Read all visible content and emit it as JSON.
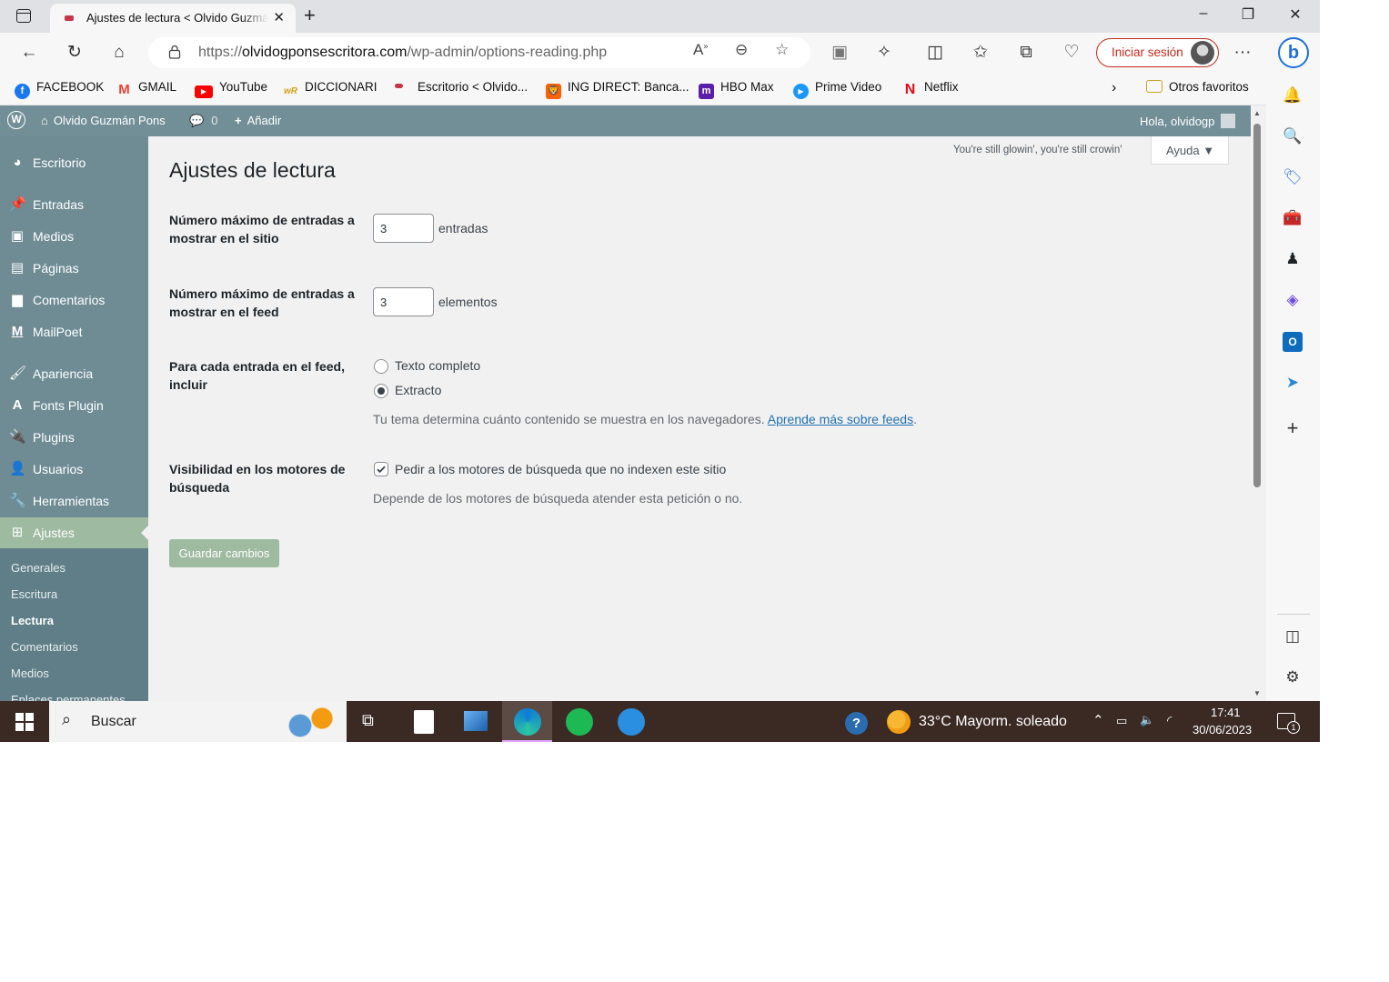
{
  "browser": {
    "tab_title": "Ajustes de lectura < Olvido Guzmán Pons — WordPress",
    "url_host": "olvidogponsescritora.com",
    "url_prefix": "https://",
    "url_path": "/wp-admin/options-reading.php",
    "signin_label": "Iniciar sesión",
    "bookmarks": [
      "FACEBOOK",
      "GMAIL",
      "YouTube",
      "DICCIONARI",
      "Escritorio < Olvido...",
      "ING DIRECT: Banca...",
      "HBO Max",
      "Prime Video",
      "Netflix"
    ],
    "other_favorites": "Otros favoritos"
  },
  "adminbar": {
    "site_name": "Olvido Guzmán Pons",
    "comments_count": "0",
    "add_label": "Añadir",
    "greeting": "Hola, olvidogp"
  },
  "sidebar": {
    "items": [
      {
        "label": "Escritorio",
        "icon": "dashboard-icon"
      },
      {
        "label": "Entradas",
        "icon": "pin-icon"
      },
      {
        "label": "Medios",
        "icon": "media-icon"
      },
      {
        "label": "Páginas",
        "icon": "page-icon"
      },
      {
        "label": "Comentarios",
        "icon": "comment-icon"
      },
      {
        "label": "MailPoet",
        "icon": "mailpoet-icon"
      },
      {
        "label": "Apariencia",
        "icon": "brush-icon"
      },
      {
        "label": "Fonts Plugin",
        "icon": "font-icon"
      },
      {
        "label": "Plugins",
        "icon": "plugin-icon"
      },
      {
        "label": "Usuarios",
        "icon": "user-icon"
      },
      {
        "label": "Herramientas",
        "icon": "wrench-icon"
      },
      {
        "label": "Ajustes",
        "icon": "settings-icon"
      }
    ],
    "submenu": [
      "Generales",
      "Escritura",
      "Lectura",
      "Comentarios",
      "Medios",
      "Enlaces permanentes"
    ]
  },
  "main": {
    "quote": "You're still glowin', you're still crowin'",
    "help_label": "Ayuda ▼",
    "title": "Ajustes de lectura",
    "posts_label": "Número máximo de entradas a mostrar en el sitio",
    "posts_value": "3",
    "posts_unit": "entradas",
    "feed_label": "Número máximo de entradas a mostrar en el feed",
    "feed_value": "3",
    "feed_unit": "elementos",
    "include_label": "Para cada entrada en el feed, incluir",
    "option_full": "Texto completo",
    "option_excerpt": "Extracto",
    "include_desc": "Tu tema determina cuánto contenido se muestra en los navegadores.",
    "include_link": "Aprende más sobre feeds",
    "include_period": ".",
    "visibility_label": "Visibilidad en los motores de búsqueda",
    "visibility_option": "Pedir a los motores de búsqueda que no indexen este sitio",
    "visibility_desc": "Depende de los motores de búsqueda atender esta petición o no.",
    "save_label": "Guardar cambios"
  },
  "taskbar": {
    "search_label": "Buscar",
    "weather": "33°C  Mayorm. soleado",
    "time": "17:41",
    "date": "30/06/2023",
    "notifications": "1"
  },
  "colors": {
    "adminbar": "#728f98",
    "sidebar": "#6f8c95",
    "accent": "#9ebaa0",
    "link": "#2271b1"
  }
}
